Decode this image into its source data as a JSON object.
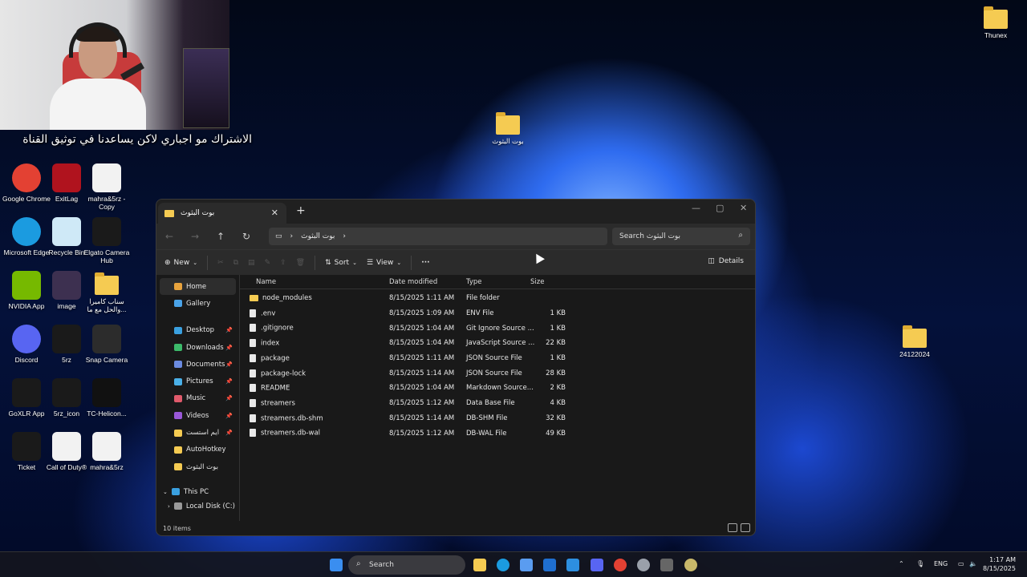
{
  "overlay": {
    "subtitle": "الاشتراك مو اجباري لاكن يساعدنا في توثيق القناة"
  },
  "desktop": {
    "left_icons": [
      {
        "label": "Google Chrome",
        "icon": "chrome-icon",
        "color": "#e34133"
      },
      {
        "label": "ExitLag",
        "icon": "exitlag-icon",
        "color": "#b0131e"
      },
      {
        "label": "mahra&5rz - Copy",
        "icon": "h-app-icon",
        "color": "#f2f2f2"
      },
      {
        "label": "Microsoft Edge",
        "icon": "edge-icon",
        "color": "#1b9be0"
      },
      {
        "label": "Recycle Bin",
        "icon": "recycle-bin-icon",
        "color": "#cfe9f7"
      },
      {
        "label": "Elgato Camera Hub",
        "icon": "elgato-icon",
        "color": "#1a1a1a"
      },
      {
        "label": "NVIDIA App",
        "icon": "nvidia-icon",
        "color": "#76b900"
      },
      {
        "label": "image",
        "icon": "image-file-icon",
        "color": "#3d3050"
      },
      {
        "label": "سناب كاميرا والحل مع ما...",
        "icon": "folder-icon",
        "color": "#f5cb52"
      },
      {
        "label": "Discord",
        "icon": "discord-icon",
        "color": "#5865f2"
      },
      {
        "label": "5rz",
        "icon": "5rz-icon",
        "color": "#1a1a1a"
      },
      {
        "label": "Snap Camera",
        "icon": "snap-camera-icon",
        "color": "#2c2c2c"
      },
      {
        "label": "GoXLR App",
        "icon": "goxlr-icon",
        "color": "#1a1a1a"
      },
      {
        "label": "5rz_icon",
        "icon": "5rz-icon",
        "color": "#1a1a1a"
      },
      {
        "label": "TC-Helicon...",
        "icon": "tc-helicon-icon",
        "color": "#111111"
      },
      {
        "label": "Ticket",
        "icon": "ticket-icon",
        "color": "#1a1a1a"
      },
      {
        "label": "Call of Duty®",
        "icon": "file-icon",
        "color": "#f2f2f2"
      },
      {
        "label": "mahra&5rz",
        "icon": "h-app-icon",
        "color": "#f2f2f2"
      }
    ],
    "right_icons": [
      {
        "label": "Thunex",
        "icon": "folder-icon"
      },
      {
        "label": "بوت البثوث",
        "icon": "folder-icon"
      },
      {
        "label": "24122024",
        "icon": "folder-icon"
      }
    ]
  },
  "explorer": {
    "tab_title": "بوت البثوث",
    "address": {
      "segment": "بوت البثوث"
    },
    "search_placeholder": "Search بوت البثوث",
    "toolbar": {
      "new": "New",
      "sort": "Sort",
      "view": "View",
      "more": "···",
      "details": "Details"
    },
    "nav": [
      {
        "label": "Home",
        "icon": "home-icon",
        "color": "#e8a33d",
        "pinned": false,
        "selected": true
      },
      {
        "label": "Gallery",
        "icon": "gallery-icon",
        "color": "#4aa3e8",
        "pinned": false
      },
      {
        "label": "Desktop",
        "icon": "desktop-icon",
        "color": "#3aa0e0",
        "pinned": true
      },
      {
        "label": "Downloads",
        "icon": "download-icon",
        "color": "#3cba6a",
        "pinned": true
      },
      {
        "label": "Documents",
        "icon": "documents-icon",
        "color": "#6b8be0",
        "pinned": true
      },
      {
        "label": "Pictures",
        "icon": "pictures-icon",
        "color": "#4ab0e8",
        "pinned": true
      },
      {
        "label": "Music",
        "icon": "music-icon",
        "color": "#e05a6b",
        "pinned": true
      },
      {
        "label": "Videos",
        "icon": "videos-icon",
        "color": "#9a58d8",
        "pinned": true
      },
      {
        "label": "ايم استست",
        "icon": "folder-icon",
        "color": "#f5cb52",
        "pinned": true
      },
      {
        "label": "AutoHotkey",
        "icon": "folder-icon",
        "color": "#f5cb52",
        "pinned": false
      },
      {
        "label": "بوت البثوث",
        "icon": "folder-icon",
        "color": "#f5cb52",
        "pinned": false
      }
    ],
    "this_pc": "This PC",
    "local_disk": "Local Disk (C:)",
    "columns": {
      "name": "Name",
      "date": "Date modified",
      "type": "Type",
      "size": "Size"
    },
    "files": [
      {
        "name": "node_modules",
        "date": "8/15/2025 1:11 AM",
        "type": "File folder",
        "size": "",
        "folder": true
      },
      {
        "name": ".env",
        "date": "8/15/2025 1:09 AM",
        "type": "ENV File",
        "size": "1 KB"
      },
      {
        "name": ".gitignore",
        "date": "8/15/2025 1:04 AM",
        "type": "Git Ignore Source ...",
        "size": "1 KB"
      },
      {
        "name": "index",
        "date": "8/15/2025 1:04 AM",
        "type": "JavaScript Source ...",
        "size": "22 KB"
      },
      {
        "name": "package",
        "date": "8/15/2025 1:11 AM",
        "type": "JSON Source File",
        "size": "1 KB"
      },
      {
        "name": "package-lock",
        "date": "8/15/2025 1:14 AM",
        "type": "JSON Source File",
        "size": "28 KB"
      },
      {
        "name": "README",
        "date": "8/15/2025 1:04 AM",
        "type": "Markdown Source...",
        "size": "2 KB"
      },
      {
        "name": "streamers",
        "date": "8/15/2025 1:12 AM",
        "type": "Data Base File",
        "size": "4 KB"
      },
      {
        "name": "streamers.db-shm",
        "date": "8/15/2025 1:14 AM",
        "type": "DB-SHM File",
        "size": "32 KB"
      },
      {
        "name": "streamers.db-wal",
        "date": "8/15/2025 1:12 AM",
        "type": "DB-WAL File",
        "size": "49 KB"
      }
    ],
    "status": "10 items"
  },
  "taskbar": {
    "search": "Search",
    "lang": "ENG",
    "time": "1:17 AM",
    "date": "8/15/2025",
    "apps": [
      {
        "icon": "start-icon",
        "color": "#3a8ef0"
      },
      {
        "icon": "file-explorer-icon",
        "color": "#f5cb52"
      },
      {
        "icon": "edge-icon",
        "color": "#1b9be0"
      },
      {
        "icon": "store-icon",
        "color": "#5a9cf0"
      },
      {
        "icon": "outlook-icon",
        "color": "#1f6fd0"
      },
      {
        "icon": "vscode-icon",
        "color": "#2d8fe0"
      },
      {
        "icon": "discord-icon",
        "color": "#5865f2"
      },
      {
        "icon": "chrome-icon",
        "color": "#e34133"
      },
      {
        "icon": "steam-icon",
        "color": "#9aa0aa"
      },
      {
        "icon": "app-icon",
        "color": "#666666"
      },
      {
        "icon": "obs-icon",
        "color": "#c8b86a"
      }
    ]
  }
}
